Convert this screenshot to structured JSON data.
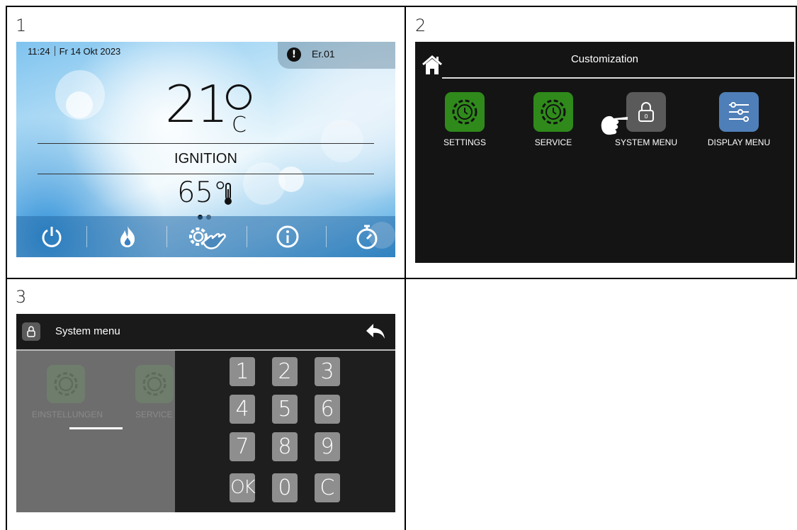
{
  "panels": {
    "p1_number": "1",
    "p2_number": "2",
    "p3_number": "3"
  },
  "screen1": {
    "time": "11:24",
    "date": "Fr 14 Okt 2023",
    "error_code": "Er.01",
    "room_temp": "21",
    "room_unit": "C",
    "status": "IGNITION",
    "water_temp": "65°",
    "bottom_bar": [
      "power-icon",
      "flame-icon",
      "gear-touch-icon",
      "info-icon",
      "timer-icon"
    ]
  },
  "screen2": {
    "title": "Customization",
    "tiles": [
      {
        "label": "SETTINGS",
        "color": "#2f8a1b",
        "icon": "gear-clock-icon"
      },
      {
        "label": "SERVICE",
        "color": "#2f8a1b",
        "icon": "gear-clock-icon"
      },
      {
        "label": "SYSTEM MENU",
        "color": "#5a5a5a",
        "icon": "lock-icon"
      },
      {
        "label": "DISPLAY MENU",
        "color": "#4f7fb8",
        "icon": "sliders-icon"
      }
    ]
  },
  "screen3": {
    "title": "System menu",
    "background_tiles": [
      "EINSTELLUNGEN",
      "SERVICE"
    ],
    "keypad": [
      "1",
      "2",
      "3",
      "4",
      "5",
      "6",
      "7",
      "8",
      "9",
      "OK",
      "0",
      "C"
    ]
  },
  "colors": {
    "green_tile": "#2f8a1b",
    "grey_tile": "#5a5a5a",
    "blue_tile": "#4f7fb8",
    "dark_bg": "#141414"
  }
}
